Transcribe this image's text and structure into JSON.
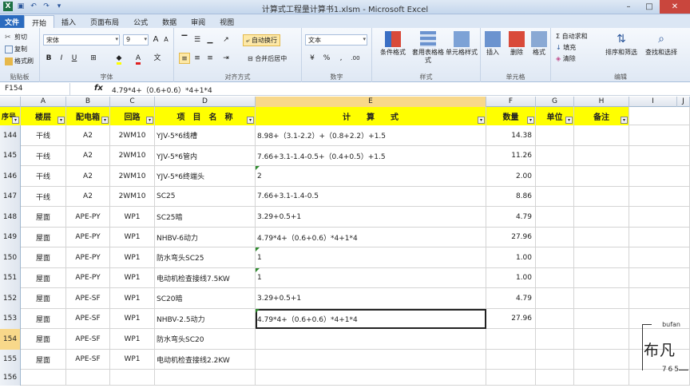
{
  "window": {
    "title": "计算式工程量计算书1.xlsm - Microsoft Excel",
    "minimize": "–",
    "maximize": "□",
    "close": "✕"
  },
  "ribbon_tabs": [
    "文件",
    "开始",
    "插入",
    "页面布局",
    "公式",
    "数据",
    "审阅",
    "视图"
  ],
  "ribbon": {
    "clipboard": {
      "cut": "剪切",
      "copy": "复制",
      "format_painter": "格式刷",
      "label": "贴贴板"
    },
    "font": {
      "name": "宋体",
      "size": "9",
      "label": "字体",
      "bold": "B",
      "italic": "I",
      "underline": "U",
      "grow": "A",
      "shrink": "A",
      "wen": "文"
    },
    "alignment": {
      "wrap": "自动换行",
      "merge": "合并后居中",
      "label": "对齐方式"
    },
    "number": {
      "format": "文本",
      "label": "数字"
    },
    "styles": {
      "cond_format": "条件格式",
      "table_format": "套用表格格式",
      "cell_styles": "单元格样式",
      "label": "样式"
    },
    "cells": {
      "insert": "插入",
      "delete": "删除",
      "format": "格式",
      "label": "单元格"
    },
    "editing": {
      "autosum": "自动求和",
      "fill": "填充",
      "clear": "清除",
      "sort_filter": "排序和筛选",
      "find_select": "查找和选择",
      "label": "编辑"
    }
  },
  "formula_bar": {
    "name_box": "F154",
    "fx": "fx",
    "content": "4.79*4+（0.6+0.6）*4+1*4"
  },
  "columns": [
    "A",
    "B",
    "C",
    "D",
    "E",
    "F",
    "G",
    "H",
    "I",
    "J"
  ],
  "header_row": {
    "row_num": "",
    "a": "序号",
    "b": "楼层",
    "c": "配电箱",
    "d": "回路",
    "e": "项　目　名　称",
    "f": "计　　算　　式",
    "g": "数量",
    "h": "单位",
    "i": "备注"
  },
  "rows": [
    {
      "n": "144",
      "b": "干线",
      "c": "A2",
      "d": "2WM10",
      "e": "YJV-5*6线槽",
      "f": "8.98+（3.1-2.2）+（0.8+2.2）+1.5",
      "g": "14.38"
    },
    {
      "n": "145",
      "b": "干线",
      "c": "A2",
      "d": "2WM10",
      "e": "YJV-5*6管内",
      "f": "7.66+3.1-1.4-0.5+（0.4+0.5）+1.5",
      "g": "11.26"
    },
    {
      "n": "146",
      "b": "干线",
      "c": "A2",
      "d": "2WM10",
      "e": "YJV-5*6终端头",
      "f": "2",
      "g": "2.00"
    },
    {
      "n": "147",
      "b": "干线",
      "c": "A2",
      "d": "2WM10",
      "e": "SC25",
      "f": "7.66+3.1-1.4-0.5",
      "g": "8.86"
    },
    {
      "n": "148",
      "b": "屋面",
      "c": "APE-PY",
      "d": "WP1",
      "e": "SC25暗",
      "f": "3.29+0.5+1",
      "g": "4.79"
    },
    {
      "n": "149",
      "b": "屋面",
      "c": "APE-PY",
      "d": "WP1",
      "e": "NHBV-6动力",
      "f": "4.79*4+（0.6+0.6）*4+1*4",
      "g": "27.96"
    },
    {
      "n": "150",
      "b": "屋面",
      "c": "APE-PY",
      "d": "WP1",
      "e": "防水弯头SC25",
      "f": "1",
      "g": "1.00"
    },
    {
      "n": "151",
      "b": "屋面",
      "c": "APE-PY",
      "d": "WP1",
      "e": "电动机检查接线7.5KW",
      "f": "1",
      "g": "1.00"
    },
    {
      "n": "152",
      "b": "屋面",
      "c": "APE-SF",
      "d": "WP1",
      "e": "SC20暗",
      "f": "3.29+0.5+1",
      "g": "4.79"
    },
    {
      "n": "153",
      "b": "屋面",
      "c": "APE-SF",
      "d": "WP1",
      "e": "NHBV-2.5动力",
      "f": "4.79*4+（0.6+0.6）*4+1*4",
      "g": "27.96"
    },
    {
      "n": "154",
      "b": "屋面",
      "c": "APE-SF",
      "d": "WP1",
      "e": "防水弯头SC20",
      "f": "",
      "g": ""
    },
    {
      "n": "155",
      "b": "屋面",
      "c": "APE-SF",
      "d": "WP1",
      "e": "电动机检查接线2.2KW",
      "f": "",
      "g": ""
    },
    {
      "n": "156",
      "b": "",
      "c": "",
      "d": "",
      "e": "",
      "f": "",
      "g": ""
    }
  ],
  "watermark": {
    "top": "bufan",
    "main": "布凡",
    "bottom": "765"
  }
}
